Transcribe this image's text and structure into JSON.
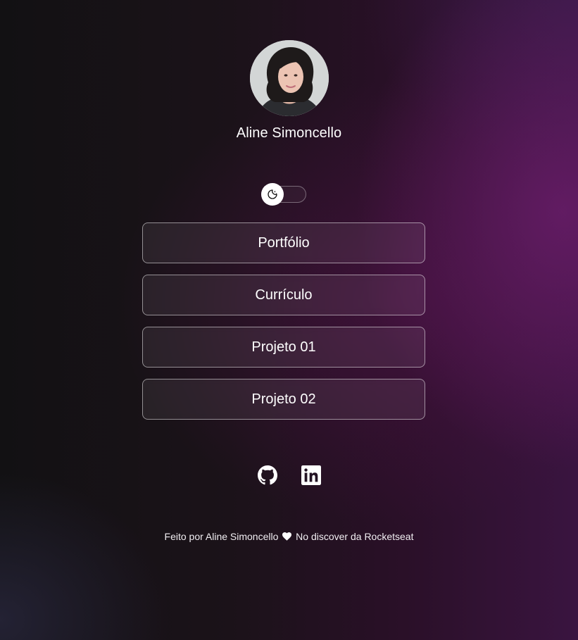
{
  "profile": {
    "name": "Aline Simoncello",
    "avatar_alt": "Aline Simoncello"
  },
  "theme_switch": {
    "icon": "moon-icon",
    "state": "dark"
  },
  "links": [
    {
      "label": "Portfólio"
    },
    {
      "label": "Currículo"
    },
    {
      "label": "Projeto 01"
    },
    {
      "label": "Projeto 02"
    }
  ],
  "social": [
    {
      "icon": "github-icon"
    },
    {
      "icon": "linkedin-icon"
    }
  ],
  "footer": {
    "before_heart": "Feito por Aline Simoncello",
    "heart_icon": "heart-icon",
    "after_heart": "No discover da Rocketseat"
  },
  "colors": {
    "background_dark": "#121113",
    "background_accent": "#6e1e6e",
    "text": "#ffffff"
  }
}
